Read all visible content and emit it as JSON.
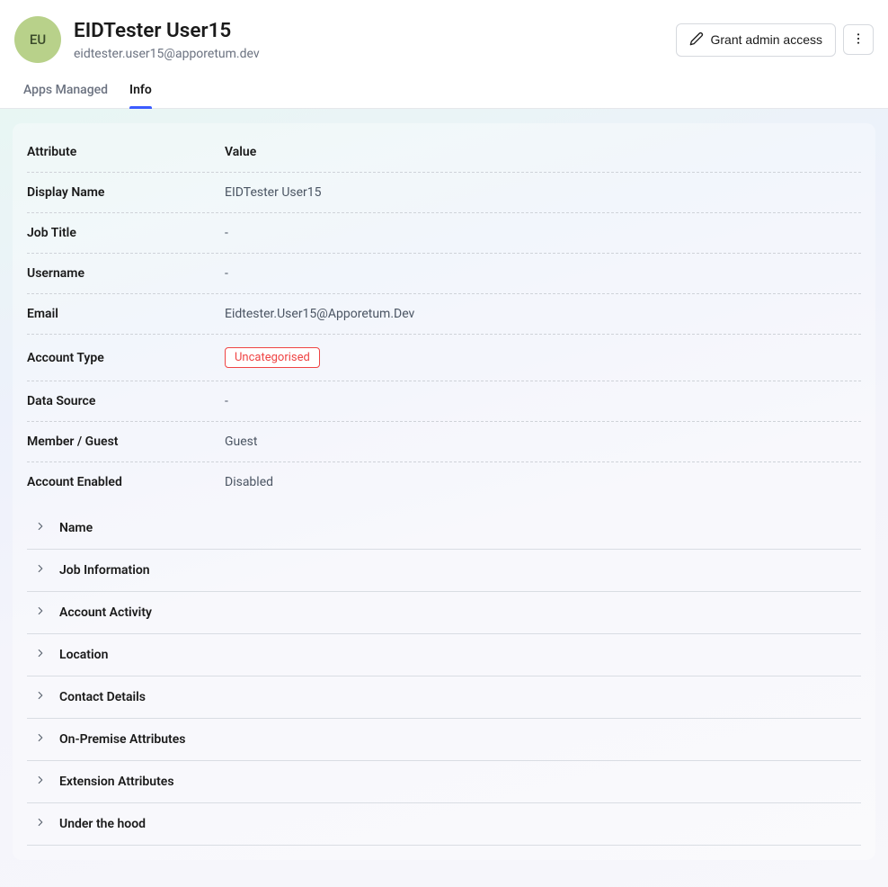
{
  "header": {
    "avatar_initials": "EU",
    "title": "EIDTester User15",
    "subtitle": "eidtester.user15@apporetum.dev",
    "grant_label": "Grant admin access"
  },
  "tabs": {
    "apps_managed": "Apps Managed",
    "info": "Info"
  },
  "table": {
    "header_attribute": "Attribute",
    "header_value": "Value",
    "rows": [
      {
        "label": "Display Name",
        "value": "EIDTester User15"
      },
      {
        "label": "Job Title",
        "value": "-"
      },
      {
        "label": "Username",
        "value": "-"
      },
      {
        "label": "Email",
        "value": "Eidtester.User15@Apporetum.Dev"
      },
      {
        "label": "Account Type",
        "value": "Uncategorised",
        "badge": true
      },
      {
        "label": "Data Source",
        "value": "-"
      },
      {
        "label": "Member / Guest",
        "value": "Guest"
      },
      {
        "label": "Account Enabled",
        "value": "Disabled"
      }
    ]
  },
  "accordion": [
    "Name",
    "Job Information",
    "Account Activity",
    "Location",
    "Contact Details",
    "On-Premise Attributes",
    "Extension Attributes",
    "Under the hood"
  ]
}
